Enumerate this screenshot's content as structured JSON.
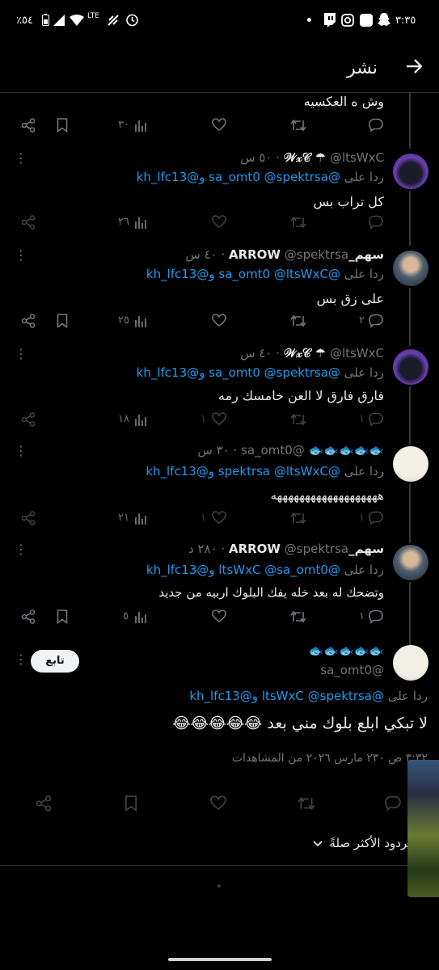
{
  "status_bar": {
    "time": "٣:٣٥",
    "battery": "٪٥٤",
    "network": "LTE"
  },
  "header": {
    "title": "نشر"
  },
  "top_partial_post": {
    "text": "وش ه العكسيه",
    "views": "٣٠"
  },
  "replies": [
    {
      "display_name": "𝒲𝓍𝒞 ☂",
      "handle": "@ltsWxC",
      "time": "٥٠ س",
      "reply_prefix": "ردا على",
      "mentions": "@sa_omt0 @spektrsa و@kh_lfc13",
      "text": "كل تراب بس",
      "replies_count": "",
      "views": "٢٦"
    },
    {
      "display_name": "سهم_ARROW",
      "handle": "@spektrsa",
      "time": "٤٠ س",
      "reply_prefix": "ردا على",
      "mentions": "@sa_omt0 @ltsWxC و@kh_lfc13",
      "text": "على زق بس",
      "replies_count": "٢",
      "views": "٢٥"
    },
    {
      "display_name": "𝒲𝓍𝒞 ☂",
      "handle": "@ltsWxC",
      "time": "٤٠ س",
      "reply_prefix": "ردا على",
      "mentions": "@sa_omt0 @spektrsa و@kh_lfc13",
      "text": "فارق فارق لا العن خامسك رمه",
      "replies_count": "١",
      "views": "١٨"
    },
    {
      "display_name": "🐟🐟🐟🐟🐟",
      "handle": "@sa_omt0",
      "time": "٣٠ س",
      "reply_prefix": "ردا على",
      "mentions": "@spektrsa @ltsWxC و@kh_lfc13",
      "text": "هههههههههههههههههههه",
      "replies_count": "١",
      "views": "٢١"
    },
    {
      "display_name": "سهم_ARROW",
      "handle": "@spektrsa",
      "time": "٢٨٠ د",
      "reply_prefix": "ردا على",
      "mentions": "@ltsWxC @sa_omt0 و@kh_lfc13",
      "text": "وتضحك له بعد خله يفك البلوك اربيه من جديد",
      "replies_count": "١",
      "views": "٥"
    }
  ],
  "focus_post": {
    "display_name": "🐟🐟🐟🐟🐟",
    "handle": "@sa_omt0",
    "follow_label": "تابع",
    "reply_prefix": "ردا على",
    "mentions": "@ltsWxC @spektrsa و@kh_lfc13",
    "text": "لا تبكي ابلع بلوك مني بعد 😂😂😂😂😂",
    "timestamp": "٣:٣٢ ص ٢٣٠ مارس ٢٠٢٦ من المشاهدات",
    "sort_label": "الردود الأكثر صلةً"
  },
  "colors": {
    "background": "#000000",
    "mention": "#1d9bf0",
    "secondary_text": "#71767b",
    "follow_button": "#eff3f4"
  }
}
